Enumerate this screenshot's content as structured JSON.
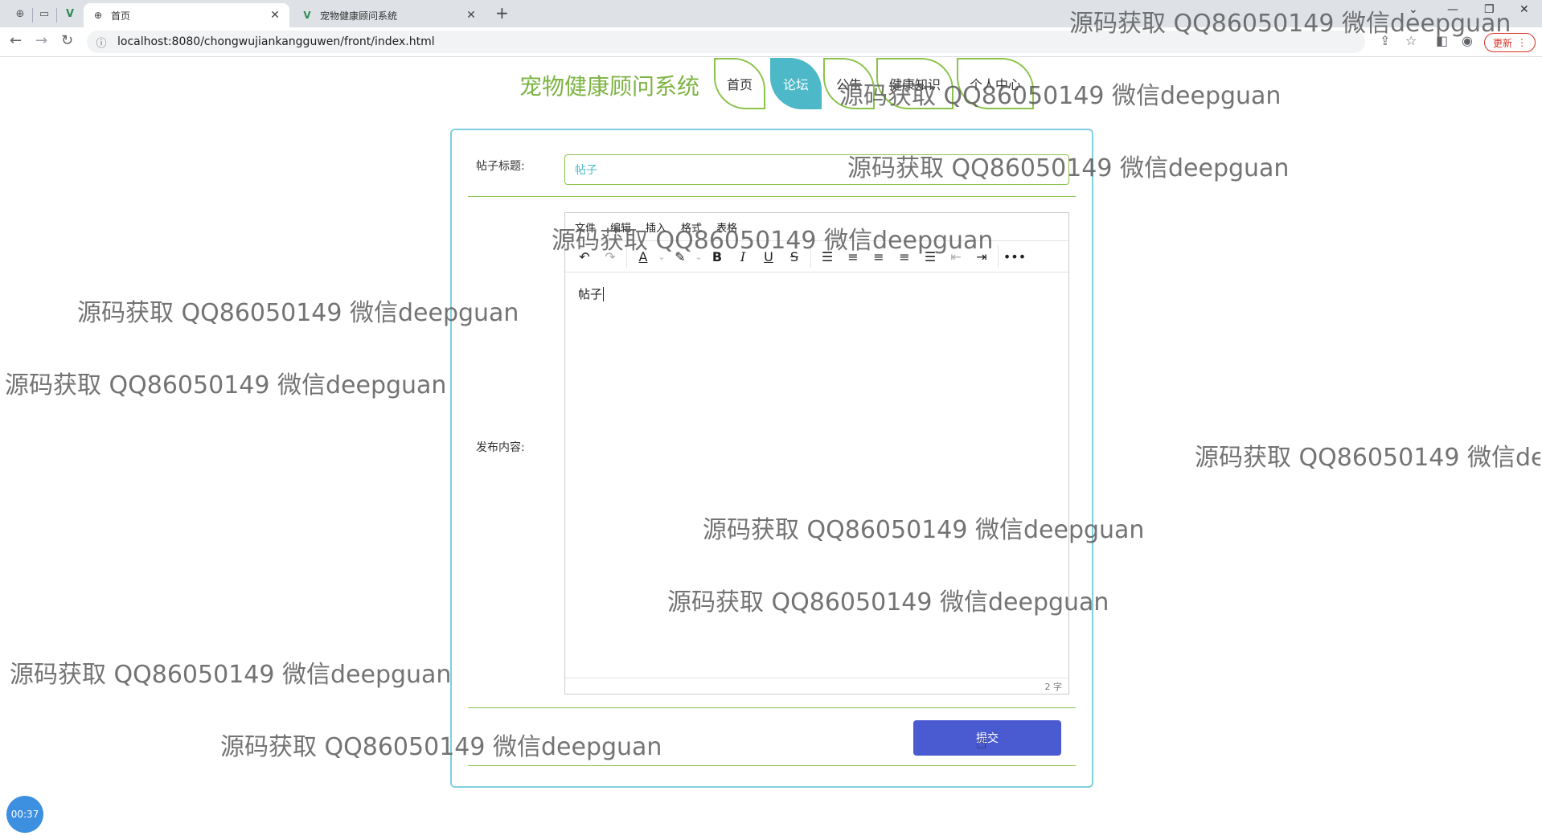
{
  "browser": {
    "tabs": [
      {
        "title": "首页",
        "active": true
      },
      {
        "title": "宠物健康顾问系统",
        "active": false
      }
    ],
    "url": "localhost:8080/chongwujiankangguwen/front/index.html",
    "update_label": "更新"
  },
  "site": {
    "brand": "宠物健康顾问系统",
    "nav": [
      {
        "label": "首页",
        "active": false
      },
      {
        "label": "论坛",
        "active": true
      },
      {
        "label": "公告",
        "active": false
      },
      {
        "label": "健康知识",
        "active": false
      },
      {
        "label": "个人中心",
        "active": false
      }
    ]
  },
  "form": {
    "title_label": "帖子标题:",
    "title_value": "帖子",
    "content_label": "发布内容:",
    "editor_menu": [
      "文件",
      "编辑",
      "插入",
      "格式",
      "表格"
    ],
    "content_value": "帖子",
    "word_count": "2 字",
    "submit_label": "提交"
  },
  "overlay": {
    "timer": "00:37",
    "watermark": "源码获取 QQ86050149 微信deepguan"
  },
  "colors": {
    "brand": "#7cb342",
    "nav_active": "#4db8c8",
    "submit": "#4a5bd1",
    "card_border": "#7fcfe0"
  }
}
